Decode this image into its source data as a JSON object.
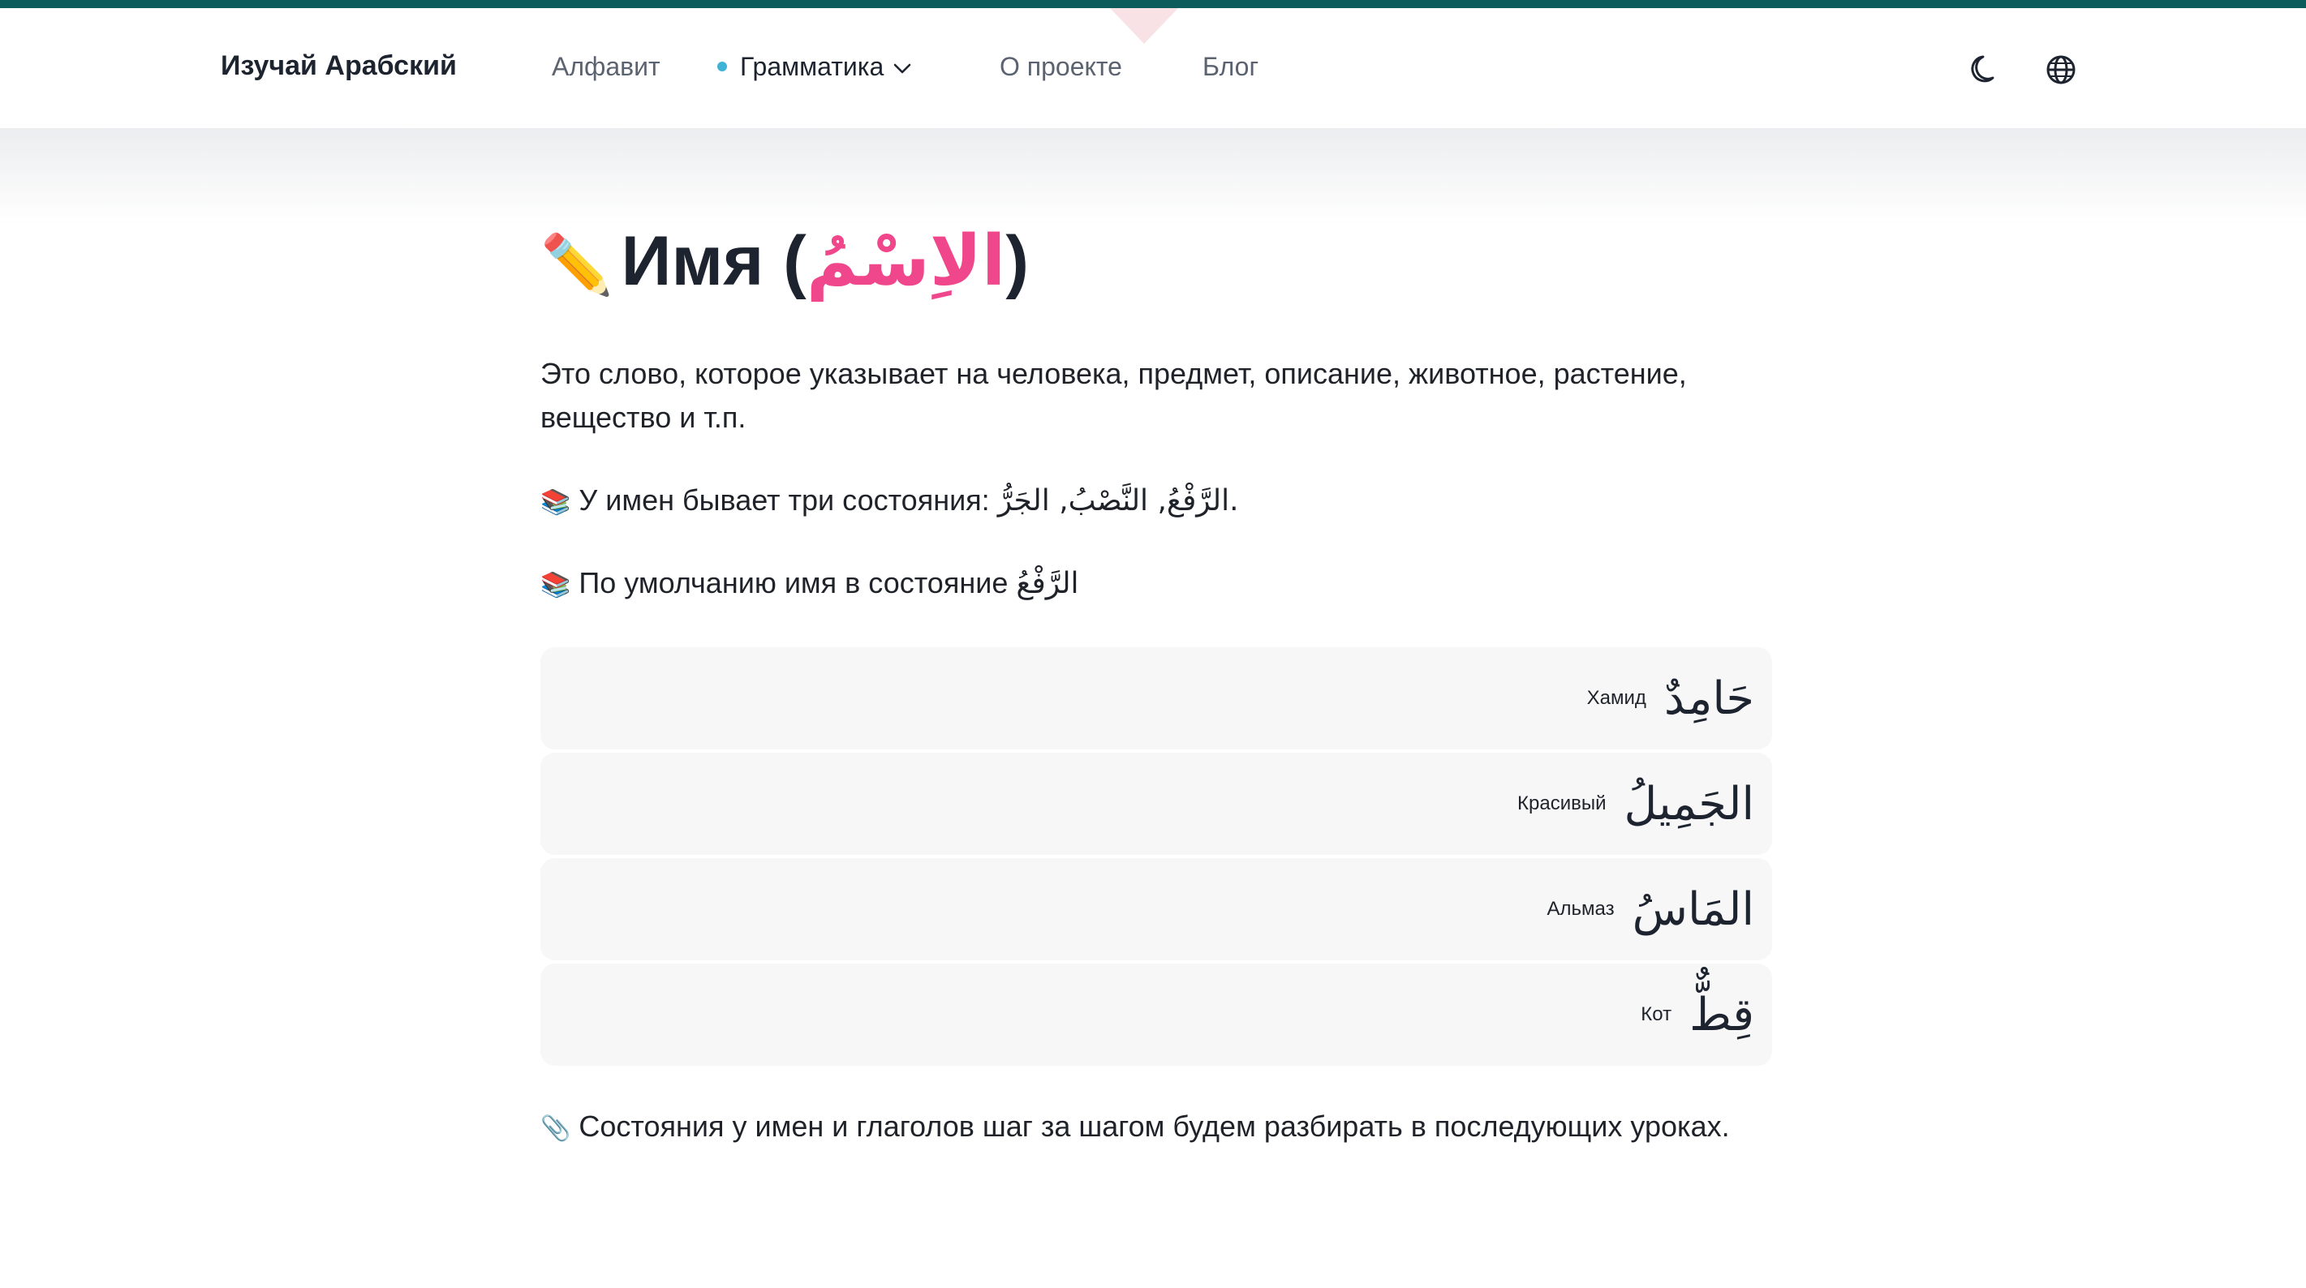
{
  "header": {
    "brand": "Изучай Арабский",
    "nav": [
      {
        "label": "Алфавит"
      },
      {
        "label": "Грамматика",
        "active": true
      },
      {
        "label": "О проекте"
      },
      {
        "label": "Блог"
      }
    ],
    "icons": [
      "moon-icon",
      "globe-icon"
    ]
  },
  "colors": {
    "accent_pink": "#f0468b",
    "topbar": "#0c5c5c",
    "active_dot": "#3fb2d6"
  },
  "article": {
    "title_emoji": "✏️",
    "title_ru": "Имя (",
    "title_ar": "الاِسْمُ",
    "title_close": ")",
    "intro": "Это слово, которое указывает на человека, предмет, описание, животное, растение, вещество и т.п.",
    "states_emoji": "📚",
    "states_text": "У имен бывает три состояния: ",
    "states_ar": "الرَّفْعُ, النَّصْبُ, الجَرُّ.",
    "default_emoji": "📚",
    "default_text": "По умолчанию имя в состояние ",
    "default_ar": "الرَّفْعُ",
    "examples": [
      {
        "ar": "حَامِدٌ",
        "ru": "Хамид"
      },
      {
        "ar": "الجَمِيلُ",
        "ru": "Красивый"
      },
      {
        "ar": "المَاسُ",
        "ru": "Альмаз"
      },
      {
        "ar": "قِطٌّ",
        "ru": "Кот"
      }
    ],
    "note_emoji": "📎",
    "note_text": "Состояния у имен и глаголов  шаг за шагом будем разбирать в последующих уроках."
  }
}
